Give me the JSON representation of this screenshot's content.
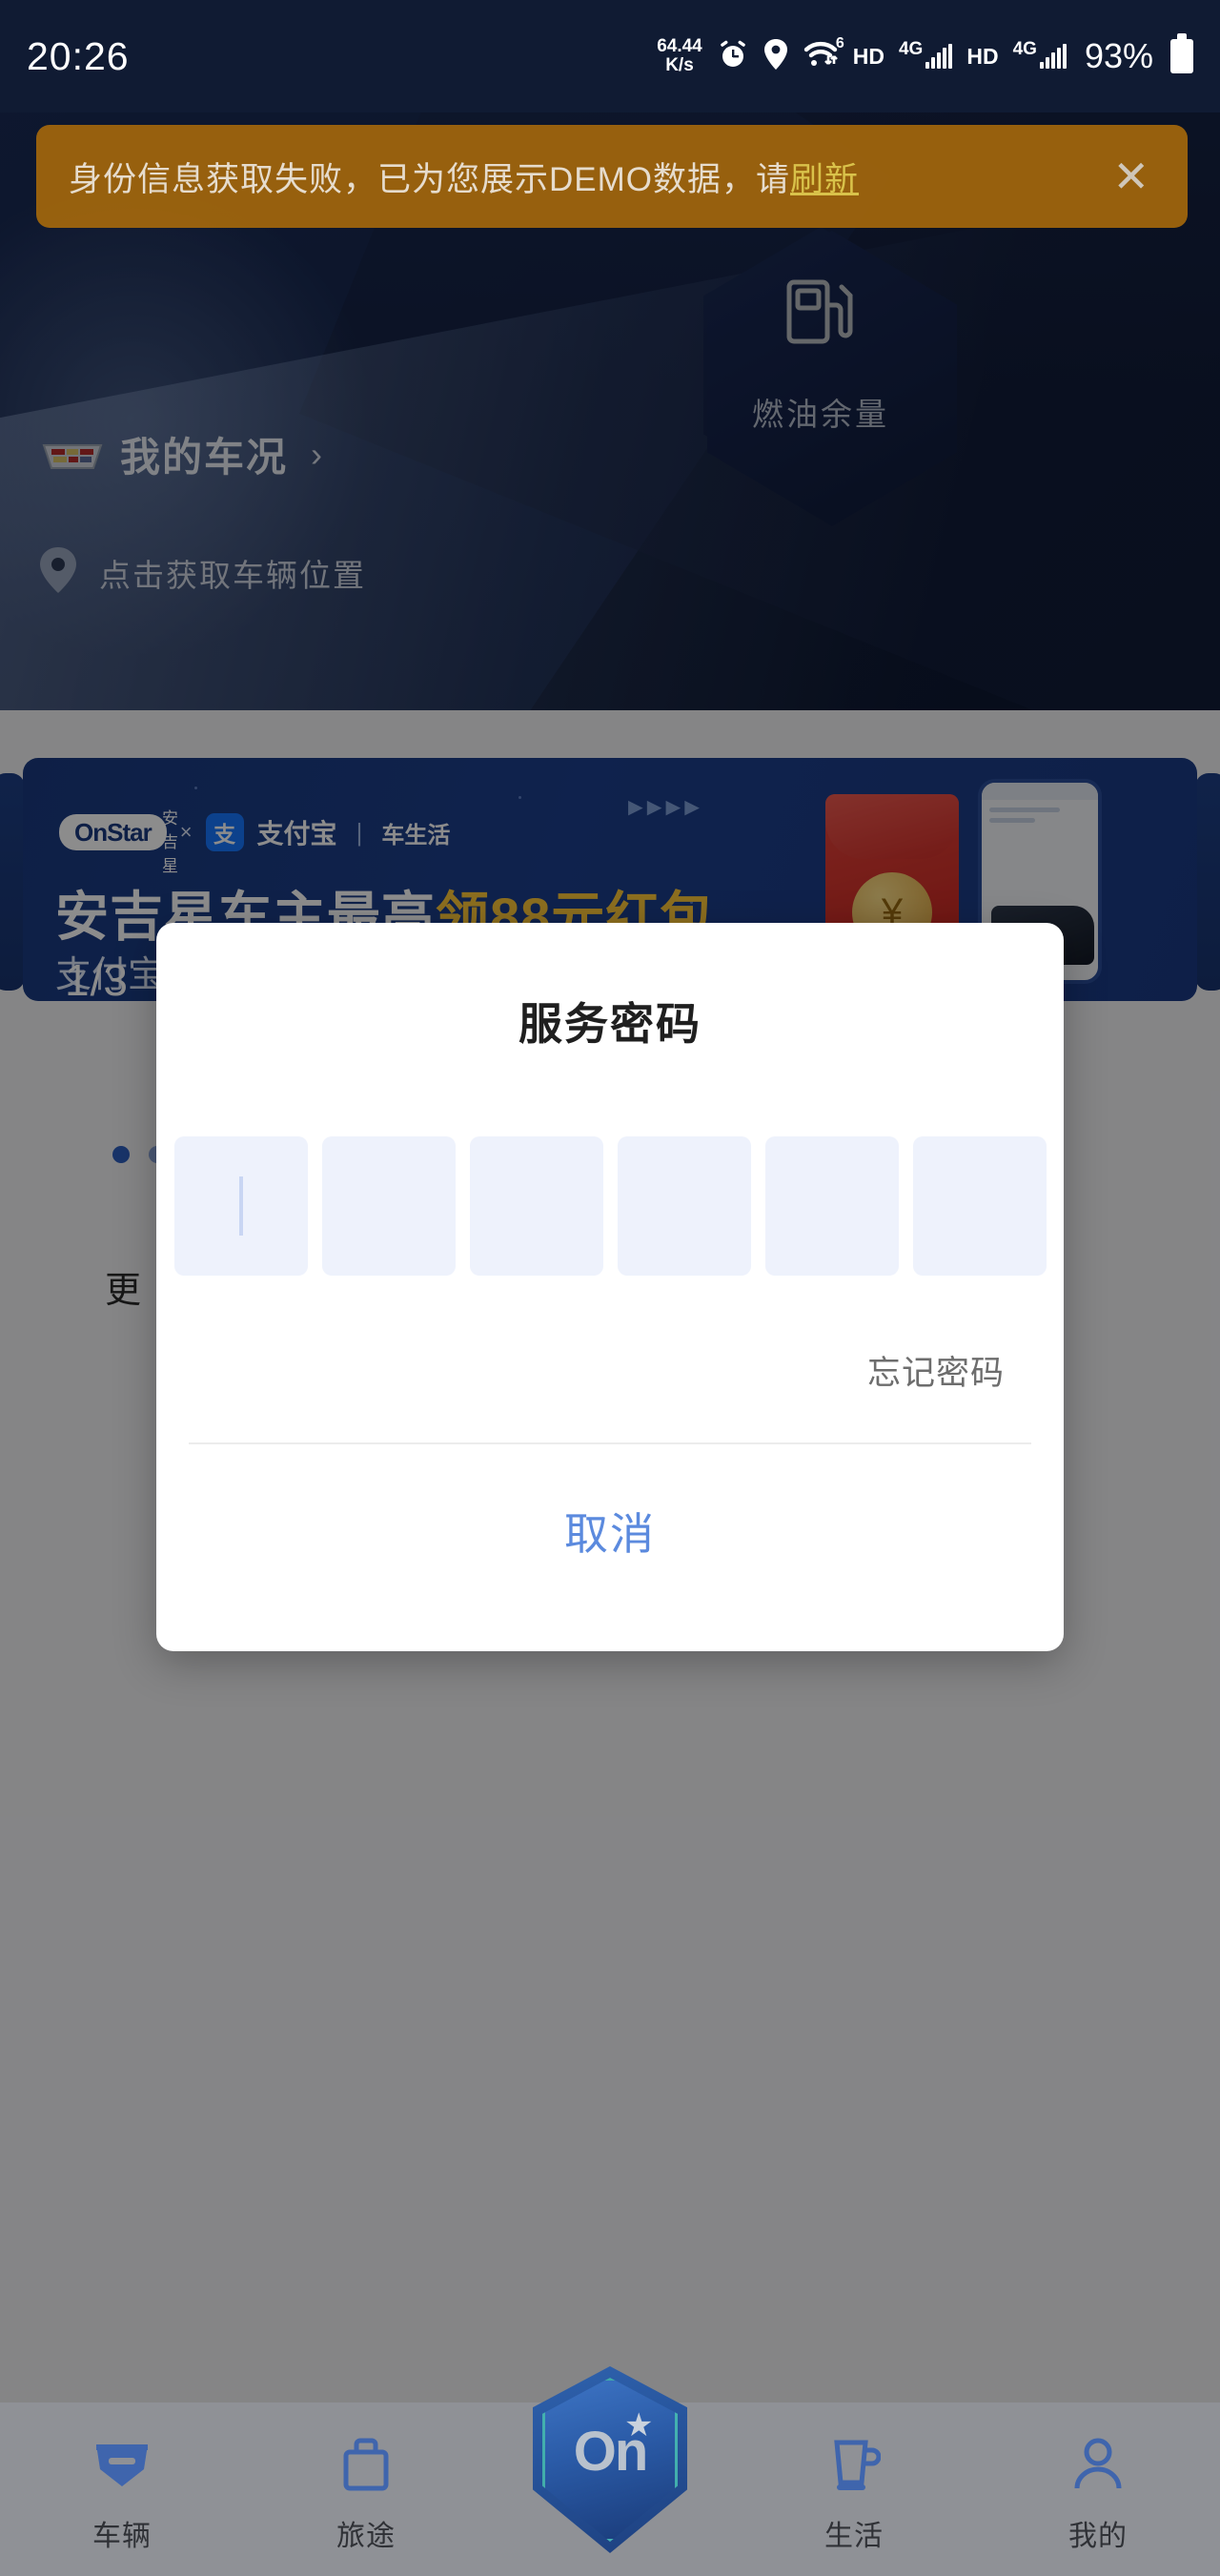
{
  "status_bar": {
    "time": "20:26",
    "net_speed_value": "64.44",
    "net_speed_unit": "K/s",
    "alarm_icon": "alarm-clock-icon",
    "location_icon": "location-pin-icon",
    "wifi_icon": "wifi-icon",
    "wifi_gen": "6",
    "hd_label_1": "HD",
    "network_1": "4G",
    "hd_label_2": "HD",
    "network_2": "4G",
    "battery_percent": "93%"
  },
  "demo_banner": {
    "message_prefix": "身份信息获取失败，已为您展示DEMO数据，请",
    "link_label": "刷新",
    "close_icon": "close-icon",
    "background_color": "#ab6b0a",
    "link_color": "#d9c24a"
  },
  "hero": {
    "vehicle_brand_icon": "cadillac-logo-icon",
    "vehicle_status_title": "我的车况",
    "chevron_icon": "chevron-right-icon",
    "location_icon": "location-pin-icon",
    "location_prompt": "点击获取车辆位置",
    "fuel_gauge": {
      "icon": "fuel-pump-icon",
      "label": "燃油余量"
    }
  },
  "carousel": {
    "page_indicator": "1/3",
    "brand_logo": "OnStar",
    "brand_logo_cn": "安吉星",
    "cross_symbol": "×",
    "partner_mark": "支",
    "partner_name": "支付宝",
    "partner_separator": "|",
    "partner_sub": "车生活",
    "headline_prefix": "安吉星车主最高",
    "headline_highlight": "领88元红包",
    "subline": "支付宝",
    "arrows_icon": "double-chevron-right-icon",
    "envelope_icon": "red-envelope-icon",
    "coin_symbol": "¥",
    "phone_icon": "phone-mockup-icon",
    "dots": [
      "active",
      "inactive"
    ],
    "more_text": "更"
  },
  "dialog": {
    "title": "服务密码",
    "otp_length": 6,
    "otp_values": [
      "",
      "",
      "",
      "",
      "",
      ""
    ],
    "forgot_label": "忘记密码",
    "cancel_label": "取消",
    "cancel_color": "#5b8ade",
    "otp_cell_color": "#eef2fc"
  },
  "bottom_nav": {
    "items": [
      {
        "label": "车辆",
        "icon": "vehicle-badge-icon"
      },
      {
        "label": "旅途",
        "icon": "travel-bag-icon"
      },
      {
        "label": "生活",
        "icon": "cup-icon"
      },
      {
        "label": "我的",
        "icon": "person-icon"
      }
    ],
    "center_button": {
      "logo_text": "On",
      "star_icon": "star-icon",
      "name": "onstar-home-button"
    }
  }
}
